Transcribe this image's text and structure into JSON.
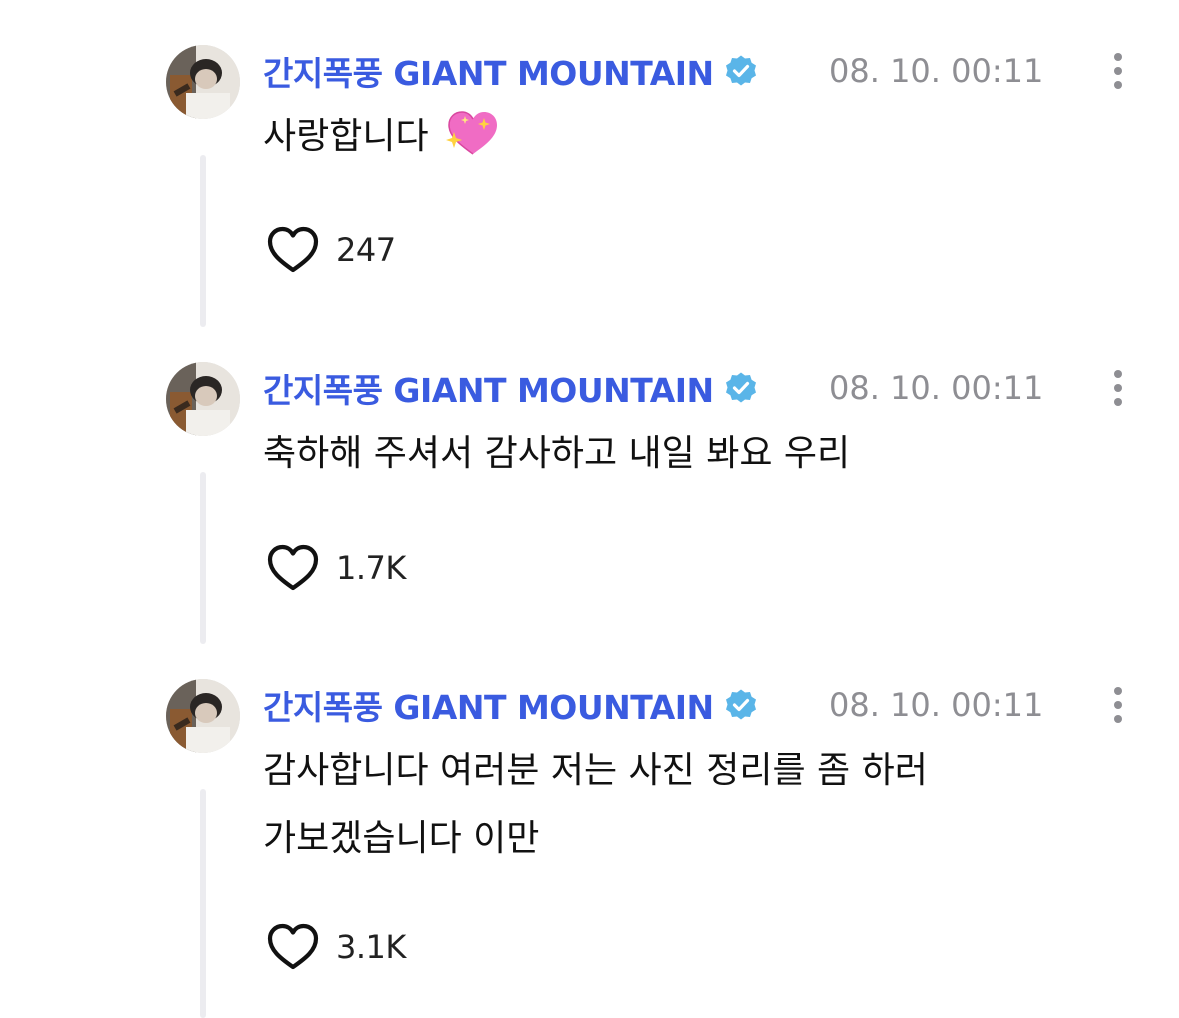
{
  "posts": [
    {
      "username": "간지폭풍 GIANT MOUNTAIN",
      "timestamp": "08. 10. 00:11",
      "content": "사랑합니다",
      "content_line2": "",
      "emoji": "sparkling-heart",
      "likes": "247"
    },
    {
      "username": "간지폭풍 GIANT MOUNTAIN",
      "timestamp": "08. 10. 00:11",
      "content": "축하해 주셔서 감사하고 내일 봐요 우리",
      "content_line2": "",
      "emoji": "",
      "likes": "1.7K"
    },
    {
      "username": "간지폭풍 GIANT MOUNTAIN",
      "timestamp": "08. 10. 00:11",
      "content": "감사합니다 여러분 저는 사진 정리를 좀 하러",
      "content_line2": "가보겠습니다 이만",
      "emoji": "",
      "likes": "3.1K"
    }
  ],
  "colors": {
    "username": "#3a5be0",
    "verified": "#5ab5e8",
    "timestamp": "#8e8e93",
    "thread_line": "#ececf0"
  },
  "icons": {
    "verified": "verified-badge-icon",
    "more": "more-vertical-icon",
    "like": "heart-outline-icon"
  }
}
